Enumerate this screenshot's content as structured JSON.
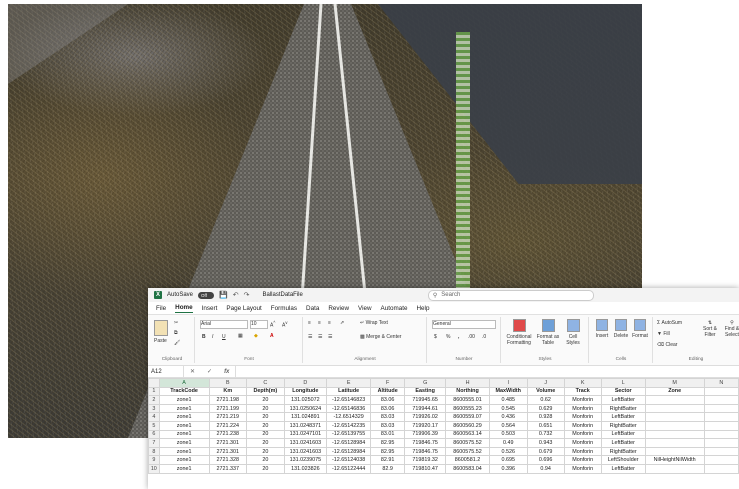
{
  "window": {
    "app_letter": "X",
    "autosave_label": "AutoSave",
    "autosave_state": "Off",
    "filename": "BallastDataFile",
    "search_placeholder": "Search"
  },
  "menu": [
    "File",
    "Home",
    "Insert",
    "Page Layout",
    "Formulas",
    "Data",
    "Review",
    "View",
    "Automate",
    "Help"
  ],
  "menu_active": "Home",
  "ribbon": {
    "clipboard": {
      "label": "Clipboard",
      "paste": "Paste"
    },
    "font": {
      "label": "Font",
      "name": "Arial",
      "size": "10",
      "bold": "B",
      "italic": "I",
      "underline": "U"
    },
    "alignment": {
      "label": "Alignment",
      "wrap": "Wrap Text",
      "merge": "Merge & Center"
    },
    "number": {
      "label": "Number",
      "format": "General",
      "currency": "$",
      "percent": "%",
      "comma": ","
    },
    "styles": {
      "label": "Styles",
      "conditional": "Conditional Formatting",
      "format_table": "Format as Table",
      "cell_styles": "Cell Styles"
    },
    "cells": {
      "label": "Cells",
      "insert": "Insert",
      "delete": "Delete",
      "format": "Format"
    },
    "editing": {
      "label": "Editing",
      "autosum": "AutoSum",
      "fill": "Fill",
      "clear": "Clear",
      "sort": "Sort & Filter",
      "find": "Find & Select"
    }
  },
  "formula_bar": {
    "cell": "A12",
    "fx": "fx",
    "value": ""
  },
  "sheet": {
    "columns": [
      "A",
      "B",
      "C",
      "D",
      "E",
      "F",
      "G",
      "H",
      "I",
      "J",
      "K",
      "L",
      "M",
      "N"
    ],
    "selected_column": "A",
    "selected_row": "12",
    "headers": [
      "TrackCode",
      "Km",
      "Depth(m)",
      "Longitude",
      "Latitude",
      "Altitude",
      "Easting",
      "Northing",
      "MaxWidth",
      "Volume",
      "Track",
      "Sector",
      "Zone",
      ""
    ],
    "rows": [
      [
        "zone1",
        "2721.198",
        "20",
        "131.025072",
        "-12.65146823",
        "83.06",
        "719945.65",
        "8600555.01",
        "0.485",
        "0.62",
        "Monforin",
        "LeftBatter",
        "",
        ""
      ],
      [
        "zone1",
        "2721.199",
        "20",
        "131.0250624",
        "-12.65146836",
        "83.06",
        "719944.61",
        "8600555.23",
        "0.545",
        "0.629",
        "Monforin",
        "RightBatter",
        "",
        ""
      ],
      [
        "zone1",
        "2721.219",
        "20",
        "131.024891",
        "-12.6514329",
        "83.03",
        "719926.02",
        "8600559.07",
        "0.436",
        "0.928",
        "Monforin",
        "LeftBatter",
        "",
        ""
      ],
      [
        "zone1",
        "2721.224",
        "20",
        "131.0248371",
        "-12.65142235",
        "83.03",
        "719920.17",
        "8600560.29",
        "0.564",
        "0.651",
        "Monforin",
        "RightBatter",
        "",
        ""
      ],
      [
        "zone1",
        "2721.238",
        "20",
        "131.0247101",
        "-12.65139755",
        "83.01",
        "719906.39",
        "8600563.14",
        "0.503",
        "0.732",
        "Monforin",
        "LeftBatter",
        "",
        ""
      ],
      [
        "zone1",
        "2721.301",
        "20",
        "131.0241603",
        "-12.65128984",
        "82.95",
        "719846.75",
        "8600575.52",
        "0.49",
        "0.943",
        "Monforin",
        "LeftBatter",
        "",
        ""
      ],
      [
        "zone1",
        "2721.301",
        "20",
        "131.0241603",
        "-12.65128984",
        "82.95",
        "719846.75",
        "8600575.52",
        "0.526",
        "0.679",
        "Monforin",
        "RightBatter",
        "",
        ""
      ],
      [
        "zone1",
        "2721.328",
        "20",
        "131.0239075",
        "-12.65124038",
        "82.91",
        "719819.32",
        "8600581.2",
        "0.695",
        "0.696",
        "Monforin",
        "LeftShoulder",
        "NilHeightNilWidth",
        ""
      ],
      [
        "zone1",
        "2721.337",
        "20",
        "131.023826",
        "-12.65122444",
        "82.9",
        "719810.47",
        "8600583.04",
        "0.396",
        "0.94",
        "Monforin",
        "LeftBatter",
        "",
        ""
      ]
    ]
  },
  "colors": {
    "excel_green": "#1f7244",
    "selection": "#d3e6d9"
  }
}
